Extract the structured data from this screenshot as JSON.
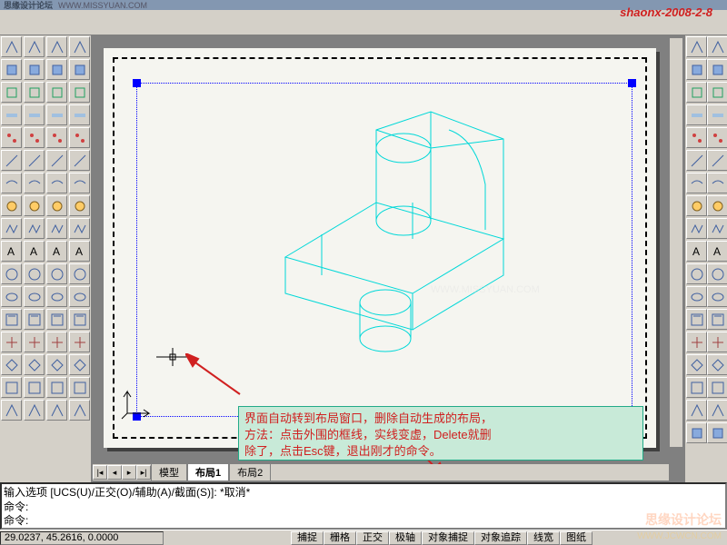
{
  "credit": "shaonx-2008-2-8",
  "titlebar": {
    "logo": "思缘设计论坛",
    "url": "WWW.MISSYUAN.COM"
  },
  "tabs": {
    "model": "模型",
    "layout1": "布局1",
    "layout2": "布局2"
  },
  "annotation": {
    "line1": "界面自动转到布局窗口，删除自动生成的布局，",
    "line2": "方法：点击外围的框线，实线变虚，Delete就删",
    "line3": "除了，点击Esc键，退出刚才的命令。"
  },
  "cmd": {
    "line1": "输入选项 [UCS(U)/正交(O)/辅助(A)/截面(S)]: *取消*",
    "line2": "命令:",
    "line3": "命令:"
  },
  "status": {
    "coords": "29.0237, 45.2616, 0.0000",
    "snap": "捕捉",
    "grid": "栅格",
    "ortho": "正交",
    "polar": "极轴",
    "osnap": "对象捕捉",
    "otrack": "对象追踪",
    "lwt": "线宽",
    "paper": "图纸"
  },
  "watermark": {
    "mid": "WWW.MISSYUAN.COM",
    "br1": "思缘设计论坛",
    "br2": "WWW.JCWCN.COM"
  }
}
